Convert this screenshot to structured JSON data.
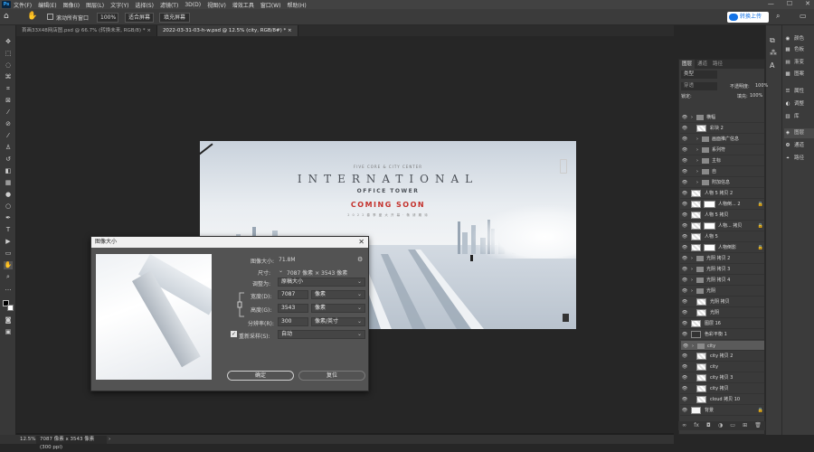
{
  "app": {
    "logo": "Ps"
  },
  "menu": [
    "文件(F)",
    "编辑(E)",
    "图像(I)",
    "图层(L)",
    "文字(Y)",
    "选择(S)",
    "滤镜(T)",
    "3D(D)",
    "视图(V)",
    "增效工具",
    "窗口(W)",
    "帮助(H)"
  ],
  "window_controls": [
    "—",
    "☐",
    "✕"
  ],
  "options": {
    "scroll_all_label": "滚动所有窗口",
    "zoom_value": "100%",
    "fit_screen": "适合屏幕",
    "fill_screen": "填充屏幕",
    "cloud_label": "转换上传"
  },
  "tabs": [
    {
      "label": "首画33X48网店图.psd @ 66.7% (转换未来, RGB/8) *",
      "active": false
    },
    {
      "label": "2022-03-31-03-h-w.psd @ 12.5% (city, RGB/8#) *",
      "active": true
    }
  ],
  "document": {
    "line1": "FIVE CORE & CITY CENTER",
    "line2": "INTERNATIONAL",
    "line3": "OFFICE TOWER",
    "line4": "COMING SOON",
    "line5": "2 0 2 2 春 季 盛 大 开 幕 · 敬 请 期 待"
  },
  "dialog": {
    "title": "图像大小",
    "close": "✕",
    "image_size_label": "图像大小:",
    "image_size_value": "71.8M",
    "dimensions_label": "尺寸:",
    "dimensions_value": "7087 像素  ×  3543 像素",
    "fit_label": "调整为:",
    "fit_value": "原稿大小",
    "width_label": "宽度(D):",
    "width_value": "7087",
    "width_unit": "像素",
    "height_label": "高度(G):",
    "height_value": "3543",
    "height_unit": "像素",
    "resolution_label": "分辨率(R):",
    "resolution_value": "300",
    "resolution_unit": "像素/英寸",
    "resample_label": "重新采样(S):",
    "resample_value": "自动",
    "resample_checked": true,
    "ok": "确定",
    "reset": "复位"
  },
  "status": {
    "zoom": "12.5%",
    "info": "7087 像素 x 3543 像素 (300 ppi)"
  },
  "right_panels": [
    "颜色",
    "色板",
    "渐变",
    "图案",
    "属性",
    "调整",
    "库",
    "图层",
    "通道",
    "路径"
  ],
  "layers_panel": {
    "tabs": [
      "图层",
      "通道",
      "路径"
    ],
    "kind_label": "类型",
    "blend": "穿透",
    "opacity_label": "不透明度:",
    "opacity": "100%",
    "lock_label": "锁定:",
    "fill_label": "填充:",
    "fill": "100%",
    "layers": [
      {
        "name": "横幅",
        "type": "folder",
        "indent": 0
      },
      {
        "name": "彩块 2",
        "type": "layer",
        "indent": 1
      },
      {
        "name": "画面推广信息",
        "type": "folder",
        "indent": 1
      },
      {
        "name": "系列符",
        "type": "folder",
        "indent": 1
      },
      {
        "name": "主标",
        "type": "folder",
        "indent": 1
      },
      {
        "name": "自",
        "type": "folder",
        "indent": 1
      },
      {
        "name": "附加信息",
        "type": "folder",
        "indent": 1
      },
      {
        "name": "人物 5 拷贝 2",
        "type": "layer",
        "indent": 0
      },
      {
        "name": "人物倒... 2",
        "type": "masked",
        "indent": 0
      },
      {
        "name": "人物 5 拷贝",
        "type": "layer",
        "indent": 0
      },
      {
        "name": "人物... 拷贝",
        "type": "masked",
        "indent": 0
      },
      {
        "name": "人物 5",
        "type": "layer",
        "indent": 0
      },
      {
        "name": "人物倒影",
        "type": "masked",
        "indent": 0
      },
      {
        "name": "光阴 拷贝 2",
        "type": "folder",
        "indent": 0
      },
      {
        "name": "光阴 拷贝 3",
        "type": "folder",
        "indent": 0
      },
      {
        "name": "光阴 拷贝 4",
        "type": "folder",
        "indent": 0
      },
      {
        "name": "光阴",
        "type": "folder",
        "indent": 0
      },
      {
        "name": "光阴 拷贝",
        "type": "layer",
        "indent": 1
      },
      {
        "name": "光阴",
        "type": "layer",
        "indent": 1
      },
      {
        "name": "图层 16",
        "type": "layer",
        "indent": 0
      },
      {
        "name": "色彩平衡 1",
        "type": "adjust",
        "indent": 0
      },
      {
        "name": "city",
        "type": "folder",
        "indent": 0,
        "selected": true
      },
      {
        "name": "city 拷贝 2",
        "type": "layer",
        "indent": 1
      },
      {
        "name": "city",
        "type": "layer",
        "indent": 1
      },
      {
        "name": "city 拷贝 3",
        "type": "layer",
        "indent": 1
      },
      {
        "name": "city 拷贝",
        "type": "layer",
        "indent": 1
      },
      {
        "name": "cloud 拷贝 10",
        "type": "layer",
        "indent": 1
      },
      {
        "name": "背景",
        "type": "background",
        "indent": 0
      }
    ],
    "footer_icons": [
      "link-icon",
      "fx-icon",
      "mask-icon",
      "adjust-icon",
      "folder-icon",
      "new-icon",
      "trash-icon"
    ]
  }
}
